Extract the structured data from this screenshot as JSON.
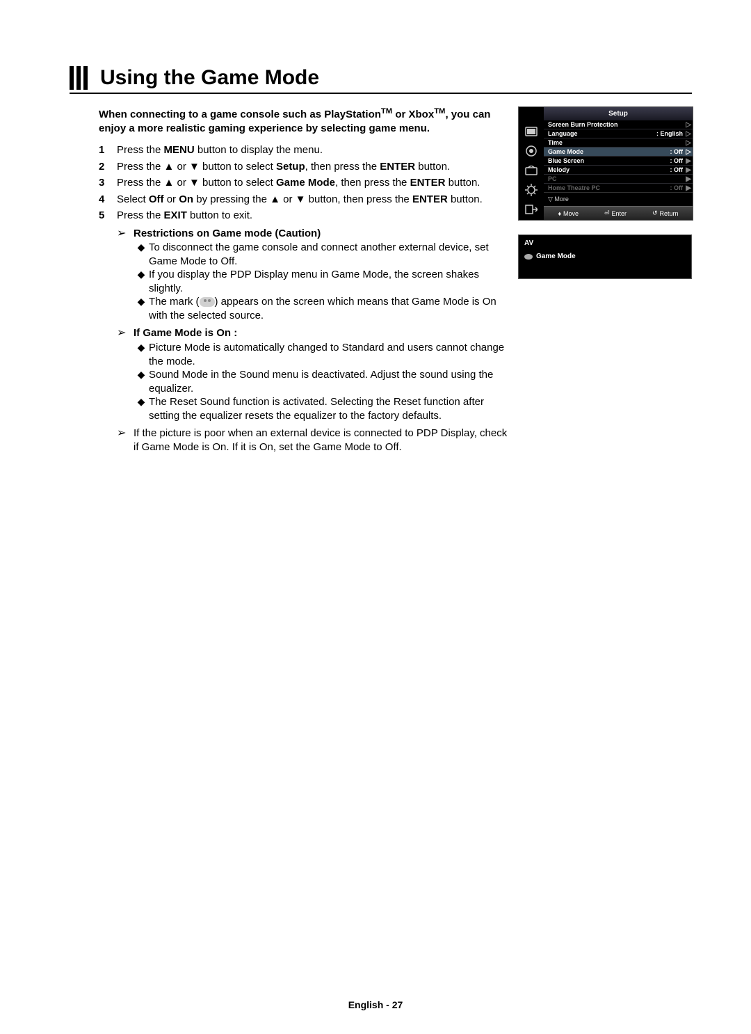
{
  "title": "Using the Game Mode",
  "intro_parts": {
    "p1": "When connecting to a game console such as PlayStation",
    "tm1": "TM",
    "p2": " or Xbox",
    "tm2": "TM",
    "p3": ", you can enjoy a more realistic gaming experience by selecting game menu."
  },
  "steps": [
    {
      "num": "1",
      "pre": "Press the ",
      "b1": "MENU",
      "post": " button to display the menu."
    },
    {
      "num": "2",
      "pre": "Press the ▲ or ▼ button to select ",
      "b1": "Setup",
      "mid": ", then press the ",
      "b2": "ENTER",
      "post": " button."
    },
    {
      "num": "3",
      "pre": "Press the ▲ or ▼ button to select ",
      "b1": "Game Mode",
      "mid": ", then press the ",
      "b2": "ENTER",
      "post": " button."
    },
    {
      "num": "4",
      "pre": "Select ",
      "b1": "Off",
      "mid": " or ",
      "b2": "On",
      "mid2": " by pressing the ▲ or ▼ button, then press the ",
      "b3": "ENTER",
      "post": " button."
    },
    {
      "num": "5",
      "pre": "Press the ",
      "b1": "EXIT",
      "post": " button to exit."
    }
  ],
  "restrictions_title": "Restrictions on Game mode (Caution)",
  "restrictions": [
    "To disconnect the game console and connect another external device, set Game Mode to Off.",
    "If you display the PDP Display menu in Game Mode, the screen shakes slightly."
  ],
  "mark_line": {
    "pre": "The mark (",
    "post": ") appears on the screen which means that Game Mode is On with the selected source."
  },
  "gameon_title": "If Game Mode is On :",
  "gameon": [
    "Picture Mode is automatically changed to Standard and users cannot change the mode.",
    "Sound Mode in the Sound menu is deactivated. Adjust the sound using the equalizer.",
    "The Reset Sound function is activated. Selecting the Reset function after setting the equalizer resets the equalizer to the factory defaults."
  ],
  "final_note": "If the picture is poor when an external device is connected to PDP Display, check if Game Mode is On. If it is On, set the Game Mode to Off.",
  "osd": {
    "title": "Setup",
    "rows": [
      {
        "label": "Screen Burn Protection",
        "val": "",
        "hl": false,
        "arrow": "▷"
      },
      {
        "label": "Language",
        "val": ": English",
        "hl": false,
        "arrow": "▷"
      },
      {
        "label": "Time",
        "val": "",
        "hl": false,
        "arrow": "▷"
      },
      {
        "label": "Game Mode",
        "val": ": Off",
        "hl": true,
        "arrow": "▷"
      },
      {
        "label": "Blue Screen",
        "val": ": Off",
        "hl": false,
        "arrow": "▶"
      },
      {
        "label": "Melody",
        "val": ": Off",
        "hl": false,
        "arrow": "▶"
      },
      {
        "label": "PC",
        "val": "",
        "hl": false,
        "dim": true,
        "arrow": "▶"
      },
      {
        "label": "Home Theatre PC",
        "val": ": Off",
        "hl": false,
        "dim": true,
        "arrow": "▶",
        "nb": true
      }
    ],
    "more": "▽ More",
    "foot": {
      "move": "Move",
      "enter": "Enter",
      "ret": "Return"
    }
  },
  "osd2": {
    "av": "AV",
    "gm": "Game Mode"
  },
  "footer": "English - 27",
  "icons": {
    "picture": "picture-icon",
    "sound": "sound-icon",
    "channel": "channel-icon",
    "setup": "setup-icon",
    "input": "input-icon",
    "updown": "updown-icon",
    "enter": "enter-icon",
    "return": "return-icon",
    "pointer": "pointer-icon",
    "diamond": "diamond-icon",
    "gamepad": "gamepad-icon"
  }
}
